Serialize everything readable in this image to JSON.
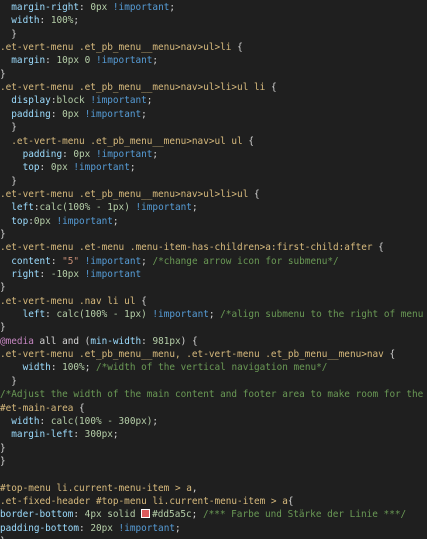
{
  "editor": {
    "lines": [
      {
        "segs": [
          [
            "prop",
            "  margin-right"
          ],
          [
            "punc",
            ": "
          ],
          [
            "num",
            "0px"
          ],
          [
            "imp",
            " !important"
          ],
          [
            "punc",
            ";"
          ]
        ]
      },
      {
        "segs": [
          [
            "prop",
            "  width"
          ],
          [
            "punc",
            ": "
          ],
          [
            "num",
            "100%"
          ],
          [
            "punc",
            ";"
          ]
        ]
      },
      {
        "segs": [
          [
            "punc",
            "  }"
          ]
        ]
      },
      {
        "segs": [
          [
            "sel",
            ".et-vert-menu .et_pb_menu__menu>nav>ul>li "
          ],
          [
            "punc",
            "{"
          ]
        ]
      },
      {
        "segs": [
          [
            "prop",
            "  margin"
          ],
          [
            "punc",
            ": "
          ],
          [
            "num",
            "10px 0"
          ],
          [
            "imp",
            " !important"
          ],
          [
            "punc",
            ";"
          ]
        ]
      },
      {
        "segs": [
          [
            "punc",
            "}"
          ]
        ]
      },
      {
        "segs": [
          [
            "sel",
            ".et-vert-menu .et_pb_menu__menu>nav>ul>li>ul li "
          ],
          [
            "punc",
            "{"
          ]
        ]
      },
      {
        "segs": [
          [
            "prop",
            "  display"
          ],
          [
            "punc",
            ":"
          ],
          [
            "val",
            "block"
          ],
          [
            "imp",
            " !important"
          ],
          [
            "punc",
            ";"
          ]
        ]
      },
      {
        "segs": [
          [
            "prop",
            "  padding"
          ],
          [
            "punc",
            ": "
          ],
          [
            "num",
            "0px"
          ],
          [
            "imp",
            " !important"
          ],
          [
            "punc",
            ";"
          ]
        ]
      },
      {
        "segs": [
          [
            "punc",
            "  }"
          ]
        ]
      },
      {
        "segs": [
          [
            "sel",
            "  .et-vert-menu .et_pb_menu__menu>nav>ul ul "
          ],
          [
            "punc",
            "{"
          ]
        ]
      },
      {
        "segs": [
          [
            "prop",
            "    padding"
          ],
          [
            "punc",
            ": "
          ],
          [
            "num",
            "0px"
          ],
          [
            "imp",
            " !important"
          ],
          [
            "punc",
            ";"
          ]
        ]
      },
      {
        "segs": [
          [
            "prop",
            "    top"
          ],
          [
            "punc",
            ": "
          ],
          [
            "num",
            "0px"
          ],
          [
            "imp",
            " !important"
          ],
          [
            "punc",
            ";"
          ]
        ]
      },
      {
        "segs": [
          [
            "punc",
            "  }"
          ]
        ]
      },
      {
        "segs": [
          [
            "sel",
            ".et-vert-menu .et_pb_menu__menu>nav>ul>li>ul "
          ],
          [
            "punc",
            "{"
          ]
        ]
      },
      {
        "segs": [
          [
            "prop",
            "  left"
          ],
          [
            "punc",
            ":"
          ],
          [
            "val",
            "calc(100% - 1px)"
          ],
          [
            "imp",
            " !important"
          ],
          [
            "punc",
            ";"
          ]
        ]
      },
      {
        "segs": [
          [
            "prop",
            "  top"
          ],
          [
            "punc",
            ":"
          ],
          [
            "num",
            "0px"
          ],
          [
            "imp",
            " !important"
          ],
          [
            "punc",
            ";"
          ]
        ]
      },
      {
        "segs": [
          [
            "punc",
            "}"
          ]
        ]
      },
      {
        "segs": [
          [
            "sel",
            ".et-vert-menu .et-menu .menu-item-has-children>a:first-child:after "
          ],
          [
            "punc",
            "{"
          ]
        ]
      },
      {
        "segs": [
          [
            "prop",
            "  content"
          ],
          [
            "punc",
            ": "
          ],
          [
            "str",
            "\"5\""
          ],
          [
            "imp",
            " !important"
          ],
          [
            "punc",
            "; "
          ],
          [
            "com",
            "/*change arrow icon for submenu*/"
          ]
        ]
      },
      {
        "segs": [
          [
            "prop",
            "  right"
          ],
          [
            "punc",
            ": "
          ],
          [
            "num",
            "-10px"
          ],
          [
            "imp",
            " !important"
          ]
        ]
      },
      {
        "segs": [
          [
            "punc",
            "}"
          ]
        ]
      },
      {
        "segs": [
          [
            "sel",
            ".et-vert-menu .nav li ul "
          ],
          [
            "punc",
            "{"
          ]
        ]
      },
      {
        "segs": [
          [
            "prop",
            "    left"
          ],
          [
            "punc",
            ": "
          ],
          [
            "val",
            "calc(100% - 1px)"
          ],
          [
            "imp",
            " !important"
          ],
          [
            "punc",
            "; "
          ],
          [
            "com",
            "/*align submenu to the right of menu link*"
          ]
        ]
      },
      {
        "segs": [
          [
            "punc",
            "}"
          ]
        ]
      },
      {
        "segs": [
          [
            "at",
            "@media"
          ],
          [
            "punc",
            " all and ("
          ],
          [
            "prop",
            "min-width"
          ],
          [
            "punc",
            ": "
          ],
          [
            "num",
            "981px"
          ],
          [
            "punc",
            ") {"
          ]
        ]
      },
      {
        "segs": [
          [
            "sel",
            ".et-vert-menu .et_pb_menu__menu, .et-vert-menu .et_pb_menu__menu>nav "
          ],
          [
            "punc",
            "{"
          ]
        ]
      },
      {
        "segs": [
          [
            "prop",
            "    width"
          ],
          [
            "punc",
            ": "
          ],
          [
            "num",
            "100%"
          ],
          [
            "punc",
            "; "
          ],
          [
            "com",
            "/*width of the vertical navigation menu*/"
          ]
        ]
      },
      {
        "segs": [
          [
            "punc",
            "  }"
          ]
        ]
      },
      {
        "segs": [
          [
            "com",
            "/*Adjust the width of the main content and footer area to make room for the fixed"
          ]
        ]
      },
      {
        "segs": [
          [
            "sel",
            "#et-main-area "
          ],
          [
            "punc",
            "{"
          ]
        ]
      },
      {
        "segs": [
          [
            "prop",
            "  width"
          ],
          [
            "punc",
            ": "
          ],
          [
            "val",
            "calc(100% - 300px)"
          ],
          [
            "punc",
            ";"
          ]
        ]
      },
      {
        "segs": [
          [
            "prop",
            "  margin-left"
          ],
          [
            "punc",
            ": "
          ],
          [
            "num",
            "300px"
          ],
          [
            "punc",
            ";"
          ]
        ]
      },
      {
        "segs": [
          [
            "punc",
            "}"
          ]
        ]
      },
      {
        "segs": [
          [
            "punc",
            "}"
          ]
        ]
      },
      {
        "segs": [
          [
            "punc",
            ""
          ]
        ]
      },
      {
        "segs": [
          [
            "sel",
            "#top-menu li.current-menu-item > a"
          ],
          [
            "punc",
            ","
          ]
        ]
      },
      {
        "segs": [
          [
            "sel",
            ".et-fixed-header #top-menu li.current-menu-item > a"
          ],
          [
            "punc",
            "{"
          ]
        ]
      },
      {
        "segs": [
          [
            "prop",
            "border-bottom"
          ],
          [
            "punc",
            ": "
          ],
          [
            "num",
            "4px"
          ],
          [
            "val",
            " solid "
          ],
          [
            "swatch",
            ""
          ],
          [
            "val",
            "#dd5a5c"
          ],
          [
            "punc",
            "; "
          ],
          [
            "com",
            "/*** Farbe und Stärke der Linie ***/"
          ]
        ]
      },
      {
        "segs": [
          [
            "prop",
            "padding-bottom"
          ],
          [
            "punc",
            ": "
          ],
          [
            "num",
            "20px"
          ],
          [
            "imp",
            " !important"
          ],
          [
            "punc",
            ";"
          ]
        ]
      },
      {
        "segs": [
          [
            "punc",
            "}"
          ]
        ]
      }
    ]
  }
}
